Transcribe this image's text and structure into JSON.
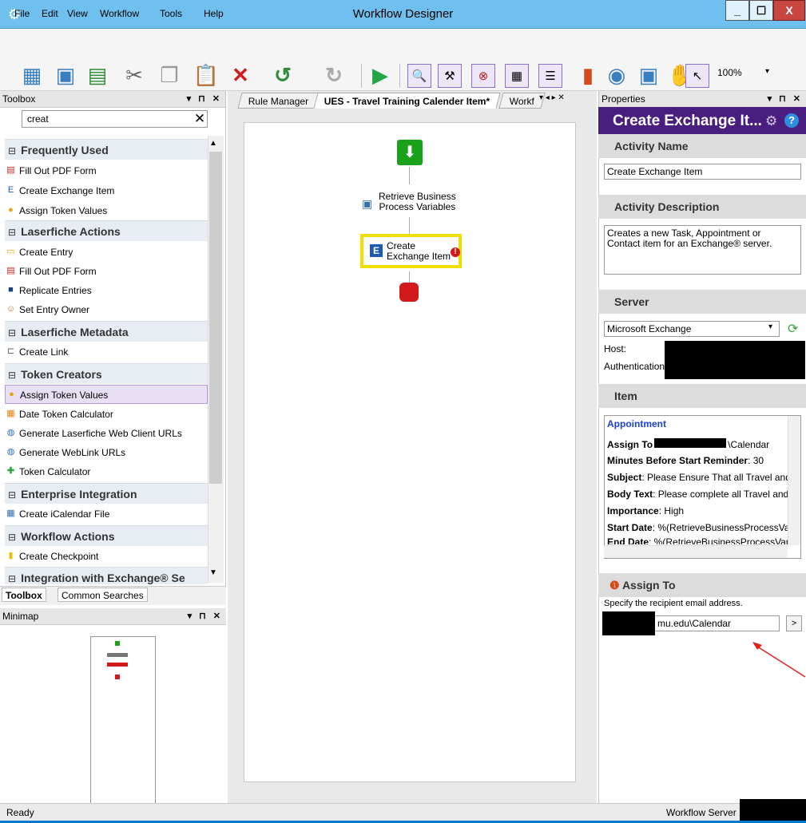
{
  "window": {
    "title": "Workflow Designer",
    "min": "_",
    "max": "☐",
    "close": "X"
  },
  "menu": [
    "File",
    "Edit",
    "View",
    "Workflow",
    "Tools",
    "Help"
  ],
  "toolbar": {
    "zoom": "100%"
  },
  "toolbox": {
    "title": "Toolbox",
    "search_value": "creat",
    "sections": [
      {
        "label": "Frequently Used",
        "items": [
          "Fill Out PDF Form",
          "Create Exchange Item",
          "Assign Token Values"
        ]
      },
      {
        "label": "Laserfiche Actions",
        "items": [
          "Create Entry",
          "Fill Out PDF Form",
          "Replicate Entries",
          "Set Entry Owner"
        ]
      },
      {
        "label": "Laserfiche Metadata",
        "items": [
          "Create Link"
        ]
      },
      {
        "label": "Token Creators",
        "items": [
          "Assign Token Values",
          "Date Token Calculator",
          "Generate Laserfiche Web Client URLs",
          "Generate WebLink URLs",
          "Token Calculator"
        ]
      },
      {
        "label": "Enterprise Integration",
        "items": [
          "Create iCalendar File"
        ]
      },
      {
        "label": "Workflow Actions",
        "items": [
          "Create Checkpoint"
        ]
      },
      {
        "label": "Integration with Exchange® Se"
      }
    ],
    "tabs": [
      "Toolbox",
      "Common Searches"
    ]
  },
  "minimap": {
    "title": "Minimap"
  },
  "tabs": [
    "Rule Manager",
    "UES - Travel Training Calender Item*",
    "Workf"
  ],
  "canvas": {
    "node_retrieve_1": "Retrieve Business",
    "node_retrieve_2": "Process Variables",
    "node_create_1": "Create",
    "node_create_2": "Exchange Item"
  },
  "properties": {
    "title": "Properties",
    "activity_title": "Create Exchange It...",
    "activity_name_label": "Activity Name",
    "activity_name_value": "Create Exchange Item",
    "activity_desc_label": "Activity Description",
    "activity_desc_value": "Creates a new Task, Appointment or Contact item for an Exchange® server.",
    "server_label": "Server",
    "server_value": "Microsoft Exchange",
    "host_label": "Host:",
    "auth_label": "Authentication:",
    "item_label": "Item",
    "item_type": "Appointment",
    "item_rows": [
      {
        "k": "Assign To",
        "v": "\\Calendar"
      },
      {
        "k": "Minutes Before Start Reminder",
        "v": ": 30"
      },
      {
        "k": "Subject",
        "v": ": Please Ensure That all Travel and"
      },
      {
        "k": "Body Text",
        "v": ": Please complete all Travel and"
      },
      {
        "k": "Importance",
        "v": ": High"
      },
      {
        "k": "Start Date",
        "v": ": %(RetrieveBusinessProcessVai"
      },
      {
        "k": "End Date",
        "v": ": %(RetrieveBusinessProcessVari"
      }
    ],
    "assign_label": "Assign To",
    "assign_help": "Specify the recipient email address.",
    "assign_value": "mu.edu\\Calendar",
    "assign_btn": ">"
  },
  "status": {
    "left": "Ready",
    "right": "Workflow Server"
  },
  "colors": {
    "titlebar": "#6fc0ee",
    "accent": "#4a1e7e",
    "highlight": "#f0de00"
  }
}
